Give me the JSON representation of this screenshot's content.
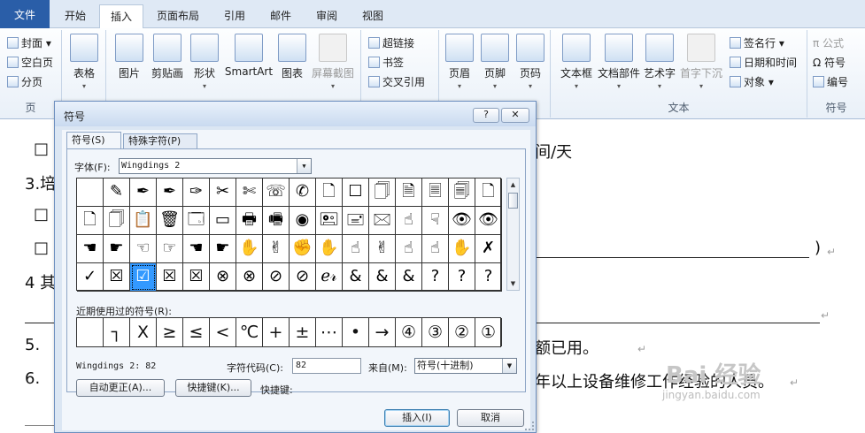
{
  "ribbon_tabs": [
    "文件",
    "开始",
    "插入",
    "页面布局",
    "引用",
    "邮件",
    "审阅",
    "视图"
  ],
  "ribbon": {
    "pages_group": {
      "items": [
        "封面",
        "空白页",
        "分页"
      ],
      "label": "页"
    },
    "table": "表格",
    "illustrations": [
      "图片",
      "剪贴画",
      "形状",
      "SmartArt",
      "图表",
      "屏幕截图"
    ],
    "links": [
      "超链接",
      "书签",
      "交叉引用"
    ],
    "header_footer": [
      "页眉",
      "页脚",
      "页码"
    ],
    "text_group": {
      "big": [
        "文本框",
        "文档部件",
        "艺术字",
        "首字下沉"
      ],
      "small": [
        "签名行",
        "日期和时间",
        "对象"
      ],
      "label": "文本"
    },
    "symbols_group": {
      "items": [
        "公式",
        "符号",
        "编号"
      ],
      "label": "符号"
    }
  },
  "document": {
    "line1": "□",
    "line1_tail": "/间/天",
    "line2": "3.培",
    "line3": "□",
    "line4": "□",
    "line4_tail": ")",
    "line5": "4 其",
    "line6": "5.",
    "line6_tail": "额已用。",
    "line7": "6.",
    "line7_tail": "年以上设备维修工作经验的人员。",
    "para_mark": "↵",
    "watermark_main": "Bai 经验",
    "watermark_url": "jingyan.baidu.com"
  },
  "dialog": {
    "title": "符号",
    "help": "?",
    "close": "✕",
    "tabs": [
      "符号(S)",
      "特殊字符(P)"
    ],
    "font_label": "字体(F):",
    "font_value": "Wingdings 2",
    "grid": [
      [
        "",
        "✎",
        "✒",
        "✒",
        "✑",
        "✂",
        "✄",
        "☏",
        "✆",
        "🗋",
        "☐",
        "🗍",
        "🗎",
        "🗏",
        "🗐",
        "🗋"
      ],
      [
        "🗋",
        "🗍",
        "📋",
        "🗑",
        "🗔",
        "▭",
        "🖶",
        "🖷",
        "◉",
        "🖭",
        "🖃",
        "🖂",
        "☝",
        "☟",
        "👁",
        "👁"
      ],
      [
        "☚",
        "☛",
        "☜",
        "☞",
        "☚",
        "☛",
        "✋",
        "✌",
        "✊",
        "✋",
        "☝",
        "✌",
        "☝",
        "☝",
        "✋",
        "✗"
      ],
      [
        "✓",
        "☒",
        "☑",
        "☒",
        "☒",
        "⊗",
        "⊗",
        "⊘",
        "⊘",
        "ℯ𝓇",
        "&",
        "&",
        "&",
        "?",
        "?",
        "?"
      ]
    ],
    "selected": "☑",
    "recent_label": "近期使用过的符号(R):",
    "recent": [
      "",
      "┐",
      "X",
      "≥",
      "≤",
      "<",
      "℃",
      "+",
      "±",
      "⋯",
      "•",
      "→",
      "④",
      "③",
      "②",
      "①"
    ],
    "char_name": "Wingdings 2: 82",
    "code_label": "字符代码(C):",
    "code_value": "82",
    "from_label": "来自(M):",
    "from_value": "符号(十进制)",
    "autocorrect_button": "自动更正(A)...",
    "shortcut_button": "快捷键(K)...",
    "shortcut_label": "快捷键:",
    "insert_button": "插入(I)",
    "cancel_button": "取消"
  },
  "colors": {
    "accent": "#2a5ea8",
    "selected": "#3399ff"
  }
}
